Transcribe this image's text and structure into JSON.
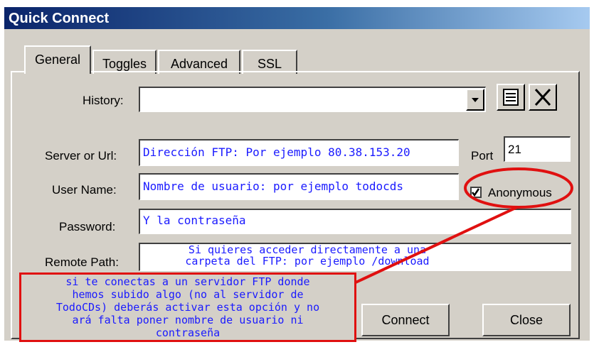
{
  "window": {
    "title": "Quick Connect"
  },
  "tabs": [
    {
      "label": "General",
      "active": true
    },
    {
      "label": "Toggles",
      "active": false
    },
    {
      "label": "Advanced",
      "active": false
    },
    {
      "label": "SSL",
      "active": false
    }
  ],
  "form": {
    "history": {
      "label": "History:",
      "value": ""
    },
    "server": {
      "label": "Server or Url:",
      "value": "Dirección FTP: Por ejemplo 80.38.153.20"
    },
    "port": {
      "label": "Port",
      "value": "21"
    },
    "username": {
      "label": "User Name:",
      "value": "Nombre de usuario: por ejemplo todocds"
    },
    "anonymous": {
      "label": "Anonymous",
      "checked": true
    },
    "password": {
      "label": "Password:",
      "value": "Y la contraseña"
    },
    "remote_path": {
      "label": "Remote Path:",
      "line1": "Si quieres acceder directamente a una",
      "line2": "carpeta del FTP: por ejemplo /download"
    }
  },
  "buttons": {
    "connect": "Connect",
    "close": "Close"
  },
  "annotation": {
    "lines": [
      "si te conectas a un servidor FTP donde",
      "hemos subido algo (no al servidor de",
      "TodoCDs) deberás activar esta opción y no",
      "ará falta poner nombre de usuario ni",
      "contraseña"
    ],
    "color": "#e01010"
  },
  "icons": {
    "dropdown": "chevron-down-icon",
    "history_list": "list-icon",
    "clear_history": "close-icon"
  }
}
